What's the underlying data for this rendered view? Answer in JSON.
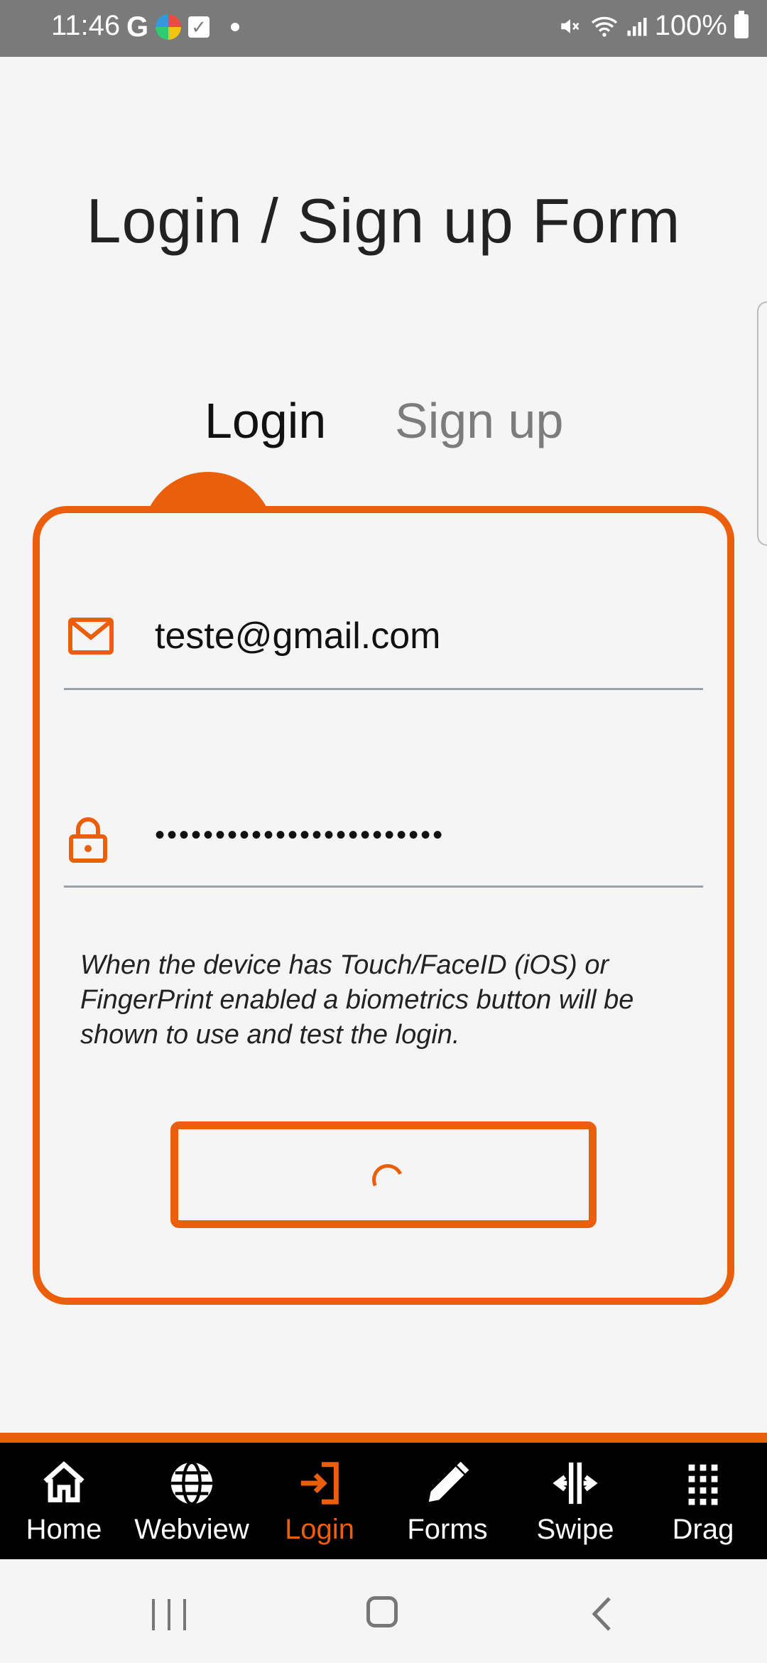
{
  "status_bar": {
    "time": "11:46",
    "battery": "100%",
    "g_label": "G",
    "check_label": "✓"
  },
  "page": {
    "title": "Login / Sign up Form"
  },
  "tabs": {
    "login": "Login",
    "signup": "Sign up"
  },
  "form": {
    "email_value": "teste@gmail.com",
    "password_value": "••••••••••••••••••••••••",
    "hint": "When the device has Touch/FaceID (iOS) or FingerPrint enabled a biometrics button will be shown to use and test the login."
  },
  "colors": {
    "accent": "#eb5e0b",
    "tabbar_bg": "#000000",
    "background": "#f5f5f5"
  },
  "tabbar": {
    "items": [
      {
        "label": "Home",
        "icon": "home-icon"
      },
      {
        "label": "Webview",
        "icon": "globe-icon"
      },
      {
        "label": "Login",
        "icon": "login-icon",
        "active": true
      },
      {
        "label": "Forms",
        "icon": "pencil-icon"
      },
      {
        "label": "Swipe",
        "icon": "swipe-icon"
      },
      {
        "label": "Drag",
        "icon": "grid-icon"
      }
    ]
  }
}
